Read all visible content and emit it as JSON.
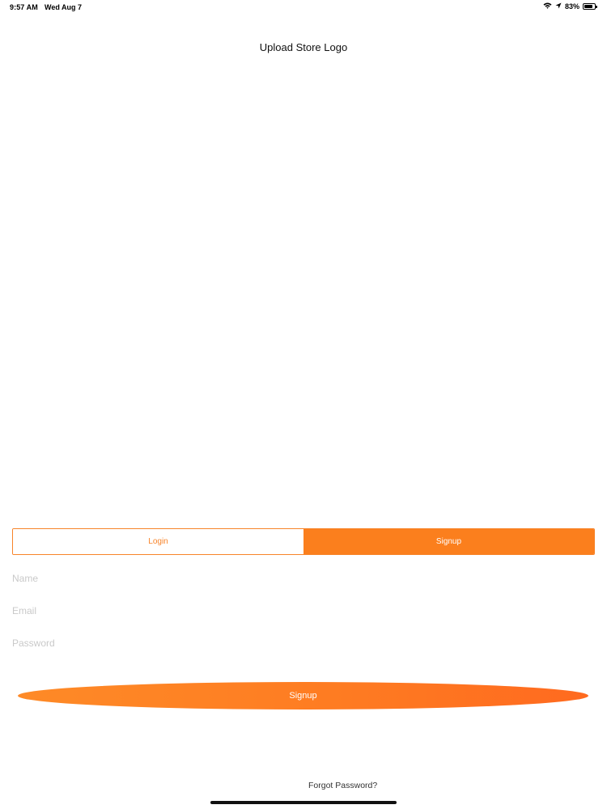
{
  "status_bar": {
    "time": "9:57 AM",
    "date": "Wed Aug 7",
    "battery": "83%",
    "battery_level": 0.83,
    "icons": [
      "wifi-icon",
      "location-icon",
      "battery-icon"
    ]
  },
  "header": {
    "upload_logo_label": "Upload Store Logo"
  },
  "tabs": {
    "login_label": "Login",
    "signup_label": "Signup",
    "selected": "Signup"
  },
  "form": {
    "name_placeholder": "Name",
    "email_placeholder": "Email",
    "password_placeholder": "Password"
  },
  "actions": {
    "signup_label": "Signup",
    "forgot_password_label": "Forgot Password?"
  },
  "colors": {
    "accent": "#fb7f1d",
    "accent_gradient_start": "#fe8a27",
    "accent_gradient_end": "#ff6a1f",
    "placeholder": "#c9c9c9"
  }
}
